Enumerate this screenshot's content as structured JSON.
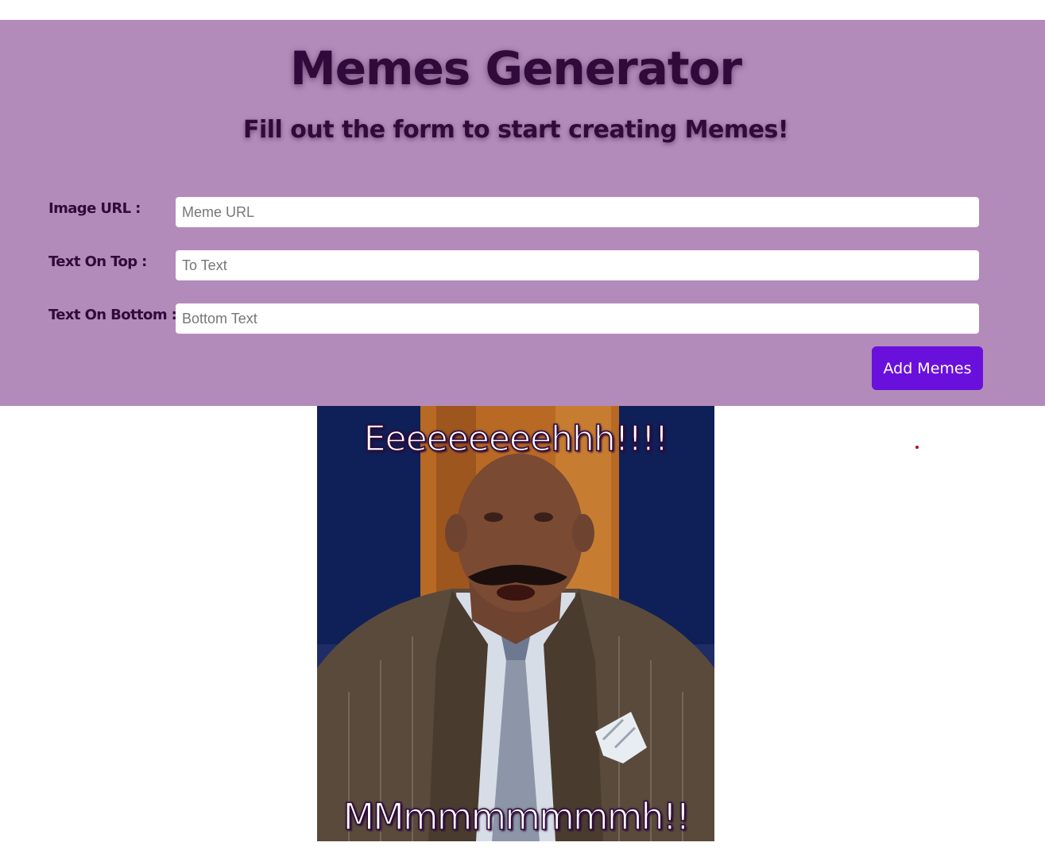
{
  "header": {
    "title": "Memes Generator",
    "subtitle": "Fill out the form to start creating Memes!"
  },
  "form": {
    "image_url": {
      "label": "Image URL :",
      "placeholder": "Meme URL",
      "value": ""
    },
    "top_text": {
      "label": "Text On Top :",
      "placeholder": "To Text",
      "value": ""
    },
    "bottom_text": {
      "label": "Text On Bottom :",
      "placeholder": "Bottom Text",
      "value": ""
    },
    "submit_label": "Add Memes"
  },
  "meme": {
    "top_text": "Eeeeeeeeehhh!!!!",
    "bottom_text": "MMmmmmmmmh!!"
  },
  "colors": {
    "panel_background": "#b38bba",
    "heading_text": "#2f0a3a",
    "button_background": "#6a10dc",
    "button_text": "#ffffff"
  }
}
